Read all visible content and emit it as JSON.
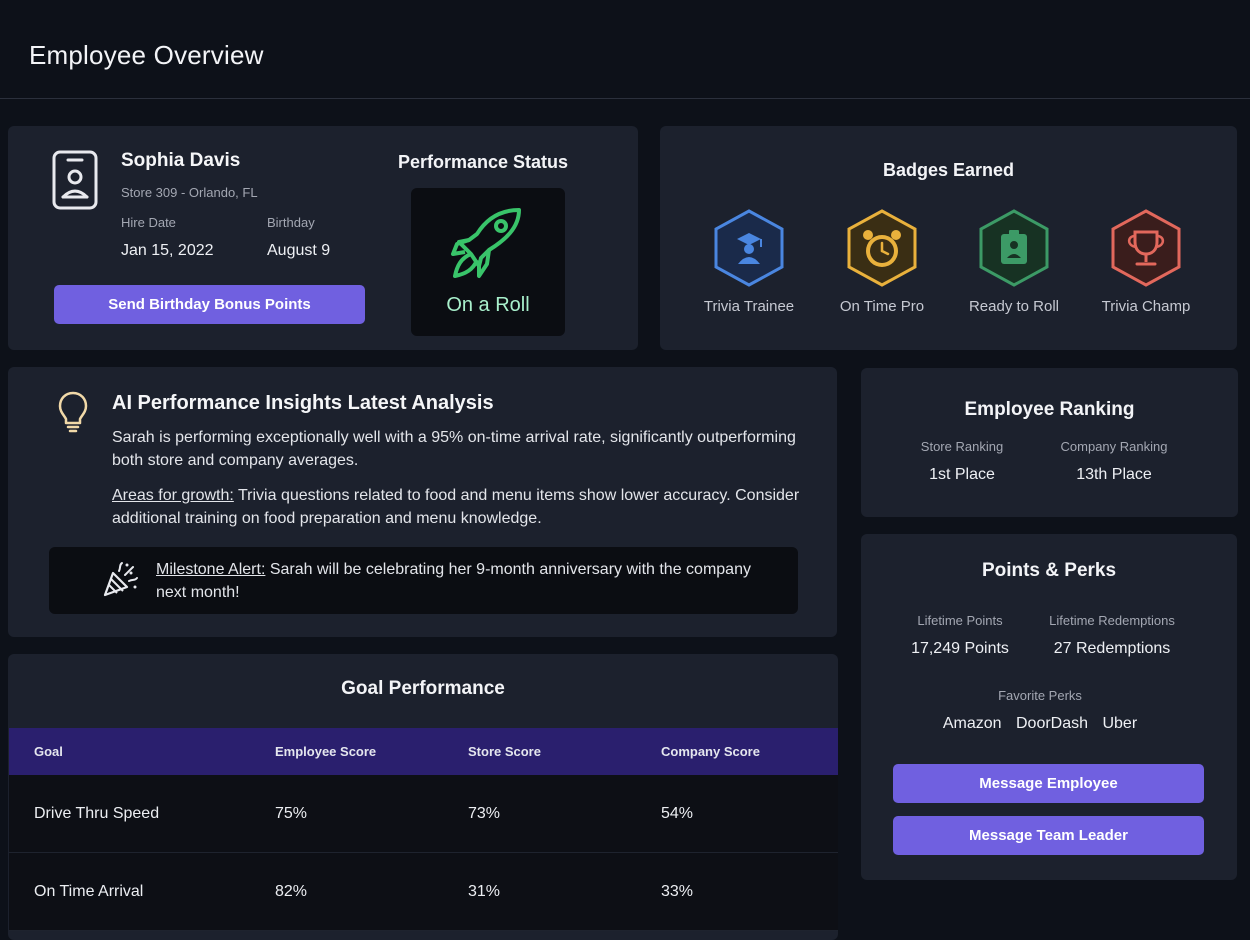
{
  "header": {
    "title": "Employee Overview"
  },
  "profile": {
    "name": "Sophia Davis",
    "store": "Store 309 - Orlando, FL",
    "hire_date_label": "Hire Date",
    "hire_date": "Jan 15, 2022",
    "birthday_label": "Birthday",
    "birthday": "August 9",
    "bonus_button": "Send Birthday Bonus Points",
    "icon": "id-badge-icon"
  },
  "performance": {
    "title": "Performance Status",
    "status": "On a Roll",
    "icon": "rocket-icon",
    "color": "#39c46a"
  },
  "badges": {
    "title": "Badges Earned",
    "items": [
      {
        "label": "Trivia Trainee",
        "icon": "graduate-icon",
        "color": "#4a86e0"
      },
      {
        "label": "On Time Pro",
        "icon": "alarm-clock-icon",
        "color": "#e9b13c"
      },
      {
        "label": "Ready to Roll",
        "icon": "id-badge-icon",
        "color": "#3c9a66"
      },
      {
        "label": "Trivia Champ",
        "icon": "trophy-icon",
        "color": "#e2685c"
      }
    ]
  },
  "insights": {
    "title": "AI Performance Insights Latest Analysis",
    "summary": "Sarah is performing exceptionally well with a 95% on-time arrival rate, significantly outperforming both store and company averages.",
    "growth_label": "Areas for growth:",
    "growth_text": " Trivia questions related to food and menu items show lower accuracy. Consider additional training on food preparation and menu knowledge.",
    "milestone_label": "Milestone Alert:",
    "milestone_text": " Sarah will be celebrating her 9-month anniversary with the company next month!"
  },
  "goals": {
    "title": "Goal Performance",
    "columns": [
      "Goal",
      "Employee Score",
      "Store Score",
      "Company Score"
    ],
    "rows": [
      [
        "Drive Thru Speed",
        "75%",
        "73%",
        "54%"
      ],
      [
        "On Time Arrival",
        "82%",
        "31%",
        "33%"
      ]
    ]
  },
  "ranking": {
    "title": "Employee Ranking",
    "store_label": "Store Ranking",
    "store_value": "1st Place",
    "company_label": "Company Ranking",
    "company_value": "13th Place"
  },
  "points": {
    "title": "Points & Perks",
    "lifetime_points_label": "Lifetime Points",
    "lifetime_points": "17,249 Points",
    "lifetime_redemptions_label": "Lifetime Redemptions",
    "lifetime_redemptions": "27 Redemptions",
    "favorite_perks_label": "Favorite Perks",
    "perks": [
      "Amazon",
      "DoorDash",
      "Uber"
    ],
    "message_employee": "Message Employee",
    "message_leader": "Message Team Leader"
  },
  "colors": {
    "background": "#0d1119",
    "card": "#1c212d",
    "accent": "#7060e0",
    "table_header": "#2a1f6e"
  }
}
